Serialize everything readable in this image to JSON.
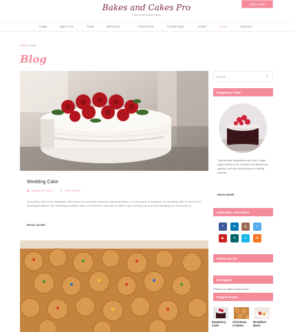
{
  "header": {
    "logo": "Bakes and Cakes Pro",
    "tagline": "Free Cake Bakery Blog",
    "order_btn": "Order Here"
  },
  "nav": [
    "HOME",
    "ABOUT US",
    "TEAM",
    "SERVICES",
    "PORTFOLIO",
    "STORE PAGE",
    "EVENT",
    "BLOG",
    "CONTACT"
  ],
  "breadcrumb": {
    "home": "Home",
    "sep": " » ",
    "current": "Blog"
  },
  "page_title": "Blog",
  "post": {
    "title": "Wedding Cake",
    "date": "January 20, 2017",
    "author": "Rara Theme",
    "excerpt": "A wedding cake is the traditional cake served at wedding receptions following dinner. In some parts of England, the wedding cake is served at a wedding breakfast; the 'wedding breakfast' does not mean the meal will be held in the morning, but at a time following the ceremony on...",
    "read_more": "READ MORE"
  },
  "sidebar": {
    "search_placeholder": "Search ...",
    "raspberry_title": "Raspberry Cake",
    "raspberry_desc": "Typical cake ingredients are flour, sugar, eggs, butter or oil, a liquid, and leavening agents, such as baking soda or baking powder.",
    "raspberry_more": "READ MORE",
    "subscribe_title": "Subscribe and Follow",
    "follow_title": "Follow Us On",
    "instagram_title": "Instagram",
    "instagram_text": "Please put valid access token",
    "popular_title": "Popular Posts",
    "popular": [
      {
        "title": "Raspberry Cake"
      },
      {
        "title": "Christmas Cookies"
      },
      {
        "title": "Breakfast Menu"
      }
    ]
  },
  "social": [
    {
      "icon": "facebook-icon",
      "glyph": "f",
      "color": "#3b5998"
    },
    {
      "icon": "linkedin-icon",
      "glyph": "in",
      "color": "#0077b5"
    },
    {
      "icon": "instagram-icon",
      "glyph": "◎",
      "color": "#9b6954"
    },
    {
      "icon": "twitter-icon",
      "glyph": "t",
      "color": "#55acee"
    },
    {
      "icon": "youtube-icon",
      "glyph": "▶",
      "color": "#cd201f"
    },
    {
      "icon": "xing-icon",
      "glyph": "✕",
      "color": "#026466"
    },
    {
      "icon": "vimeo-icon",
      "glyph": "v",
      "color": "#1ab7ea"
    },
    {
      "icon": "odnoklassniki-icon",
      "glyph": "ok",
      "color": "#f4731c"
    }
  ],
  "colors": {
    "accent": "#f48a9a"
  }
}
